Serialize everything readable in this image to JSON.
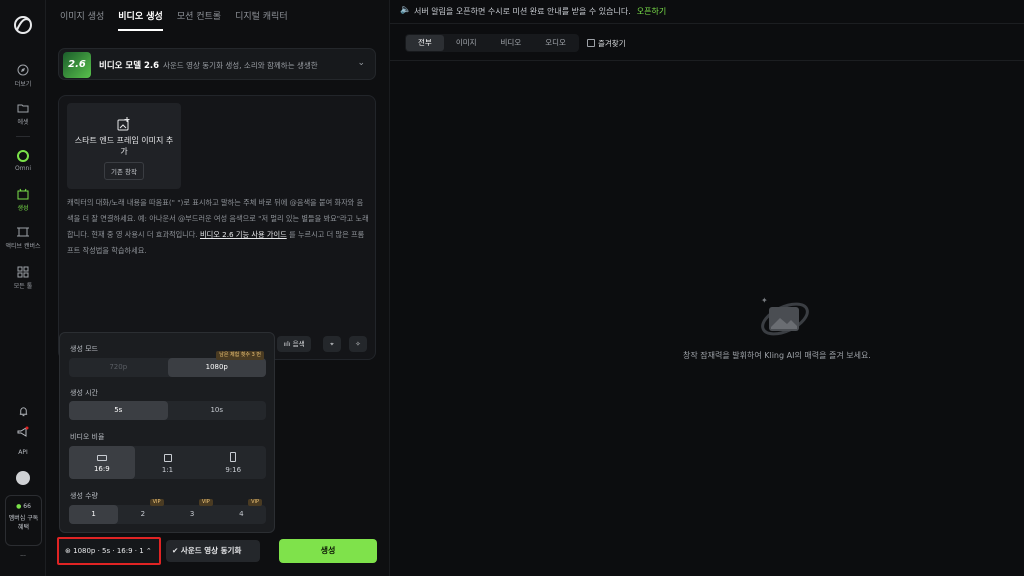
{
  "rail": {
    "items": [
      {
        "label": "더보기",
        "icon": "compass-icon"
      },
      {
        "label": "에셋",
        "icon": "folder-icon"
      },
      {
        "label": "Omni",
        "icon": "omni-icon"
      },
      {
        "label": "생성",
        "icon": "create-icon"
      },
      {
        "label": "액티브 캔버스",
        "icon": "canvas-icon"
      },
      {
        "label": "모든 툴",
        "icon": "grid-icon"
      }
    ],
    "api_label": "API",
    "credits": "66",
    "member_label": "멤버십 구독 혜택",
    "more": "···"
  },
  "tabs": [
    "이미지 생성",
    "비디오 생성",
    "모션 컨트롤",
    "디지털 캐릭터"
  ],
  "model": {
    "thumb_text": "2.6",
    "name": "비디오 모델 2.6",
    "desc": "사운드 영상 동기화 생성, 소리와 함께하는 생생한"
  },
  "frame": {
    "title": "스타트 엔드 프레임 이미지 추가",
    "button": "기존 창작"
  },
  "prompt": {
    "text": "캐릭터의 대화/노래 내용을 따옴표(\" \")로 표시하고 말하는 주체 바로 뒤에 @음색을 붙여 화자와 음색을 더 잘 연결하세요. 예: 아나운서 @부드러운 여성 음색으로 \"저 멀리 있는 별들을 봐요\"라고 노래합니다. 현재 중 영 사용시 더 효과적입니다.",
    "link": "비디오 2.6 기능 사용 가이드",
    "after": "를 누르시고 더 많은 프롬프트 작성법을 학습하세요."
  },
  "tools": {
    "voice": "음색"
  },
  "settings": {
    "mode_label": "생성 모드",
    "mode_options": [
      "720p",
      "1080p"
    ],
    "mode_badge": "남은 체험 횟수 3 번",
    "time_label": "생성 시간",
    "time_options": [
      "5s",
      "10s"
    ],
    "ratio_label": "비디오 비율",
    "ratio_options": [
      "16:9",
      "1:1",
      "9:16"
    ],
    "count_label": "생성 수량",
    "count_options": [
      "1",
      "2",
      "3",
      "4"
    ],
    "vip": "VIP"
  },
  "bottom": {
    "summary": "1080p · 5s · 16:9 · 1",
    "sync": "사운드 영상 동기화",
    "generate": "생성"
  },
  "notice": {
    "text": "서버 알림을 오픈하면 수시로 미션 완료 안내를 받을 수 있습니다.",
    "link": "오픈하기"
  },
  "filters": [
    "전부",
    "이미지",
    "비디오",
    "오디오"
  ],
  "favorites": "즐겨찾기",
  "empty": "창작 잠재력을 발휘하여 Kling AI의 매력을 즐겨 보세요.",
  "colors": {
    "accent": "#7be24a",
    "highlight": "#e02424"
  }
}
